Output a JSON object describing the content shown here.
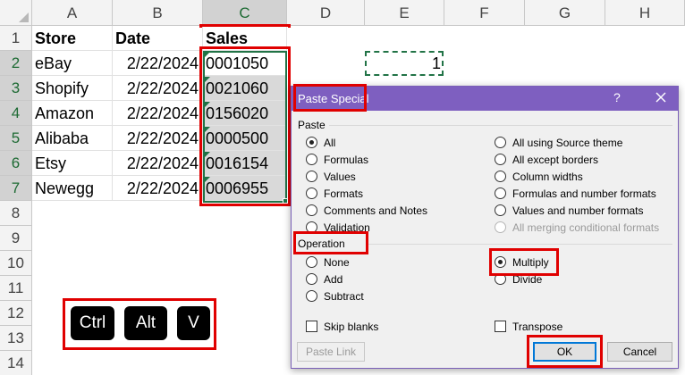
{
  "sheet": {
    "columns": [
      "A",
      "B",
      "C",
      "D",
      "E",
      "F",
      "G",
      "H"
    ],
    "rows": [
      "1",
      "2",
      "3",
      "4",
      "5",
      "6",
      "7",
      "8",
      "9",
      "10",
      "11",
      "12",
      "13",
      "14"
    ],
    "header": {
      "store": "Store",
      "date": "Date",
      "sales": "Sales"
    },
    "data": [
      {
        "store": "eBay",
        "date": "2/22/2024",
        "sales": "0001050"
      },
      {
        "store": "Shopify",
        "date": "2/22/2024",
        "sales": "0021060"
      },
      {
        "store": "Amazon",
        "date": "2/22/2024",
        "sales": "0156020"
      },
      {
        "store": "Alibaba",
        "date": "2/22/2024",
        "sales": "0000500"
      },
      {
        "store": "Etsy",
        "date": "2/22/2024",
        "sales": "0016154"
      },
      {
        "store": "Newegg",
        "date": "2/22/2024",
        "sales": "0006955"
      }
    ],
    "copied_value": "1",
    "accent_color": "#217346"
  },
  "keys": [
    "Ctrl",
    "Alt",
    "V"
  ],
  "dialog": {
    "title": "Paste Special",
    "help": "?",
    "paste_label": "Paste",
    "paste_left": [
      "All",
      "Formulas",
      "Values",
      "Formats",
      "Comments and Notes",
      "Validation"
    ],
    "paste_right": [
      "All using Source theme",
      "All except borders",
      "Column widths",
      "Formulas and number formats",
      "Values and number formats",
      "All merging conditional formats"
    ],
    "paste_selected": "All",
    "operation_label": "Operation",
    "operation_left": [
      "None",
      "Add",
      "Subtract"
    ],
    "operation_right": [
      "Multiply",
      "Divide"
    ],
    "operation_selected": "Multiply",
    "skip_blanks": "Skip blanks",
    "transpose": "Transpose",
    "paste_link": "Paste Link",
    "ok": "OK",
    "cancel": "Cancel",
    "title_color": "#7e5fc0",
    "highlight_color": "#e00000"
  }
}
